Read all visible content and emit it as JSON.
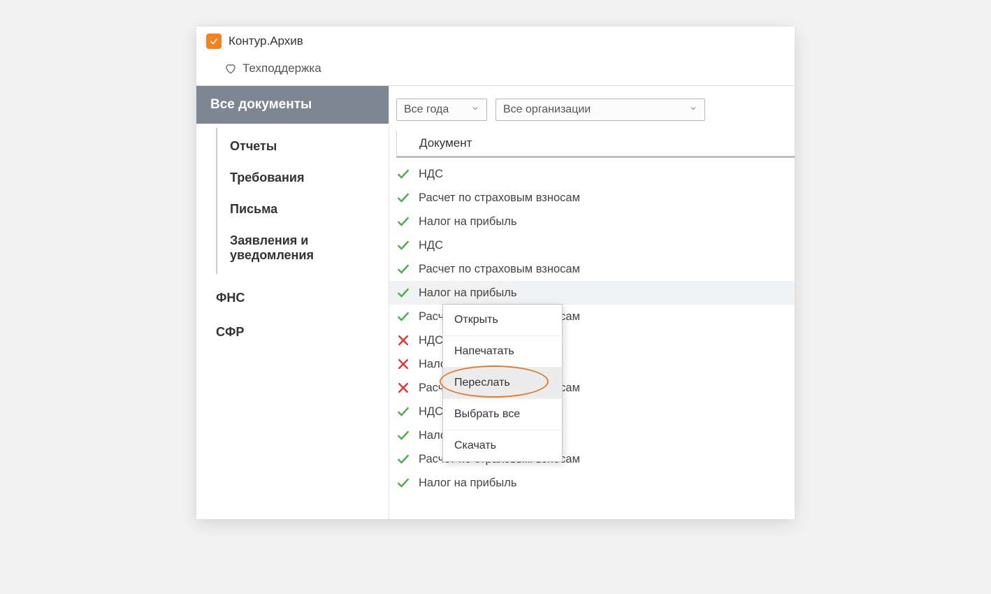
{
  "app": {
    "title": "Контур.Архив"
  },
  "support": {
    "label": "Техподдержка"
  },
  "sidebar": {
    "selected": "Все документы",
    "children": [
      {
        "label": "Отчеты"
      },
      {
        "label": "Требования"
      },
      {
        "label": "Письма"
      },
      {
        "label": "Заявления и уведомления"
      }
    ],
    "top": [
      {
        "label": "ФНС"
      },
      {
        "label": "СФР"
      }
    ]
  },
  "filters": {
    "year": "Все года",
    "org": "Все организации"
  },
  "columns": {
    "doc": "Документ"
  },
  "docs": [
    {
      "status": "ok",
      "name": "НДС"
    },
    {
      "status": "ok",
      "name": "Расчет по страховым взносам"
    },
    {
      "status": "ok",
      "name": "Налог на прибыль"
    },
    {
      "status": "ok",
      "name": "НДС"
    },
    {
      "status": "ok",
      "name": "Расчет по страховым взносам"
    },
    {
      "status": "ok",
      "name": "Налог на прибыль",
      "highlight": true
    },
    {
      "status": "ok",
      "name": "Расчет по страховым взносам"
    },
    {
      "status": "err",
      "name": "НДС"
    },
    {
      "status": "err",
      "name": "Налог на прибыль"
    },
    {
      "status": "err",
      "name": "Расчет по страховым взносам"
    },
    {
      "status": "ok",
      "name": "НДС"
    },
    {
      "status": "ok",
      "name": "Налог на прибыль"
    },
    {
      "status": "ok",
      "name": "Расчет по страховым взносам"
    },
    {
      "status": "ok",
      "name": "Налог на прибыль"
    }
  ],
  "context_menu": {
    "items": [
      {
        "label": "Открыть"
      },
      {
        "label": "Напечатать"
      },
      {
        "label": "Переслать",
        "hover": true,
        "circled": true
      },
      {
        "label": "Выбрать все"
      },
      {
        "label": "Скачать"
      }
    ]
  }
}
